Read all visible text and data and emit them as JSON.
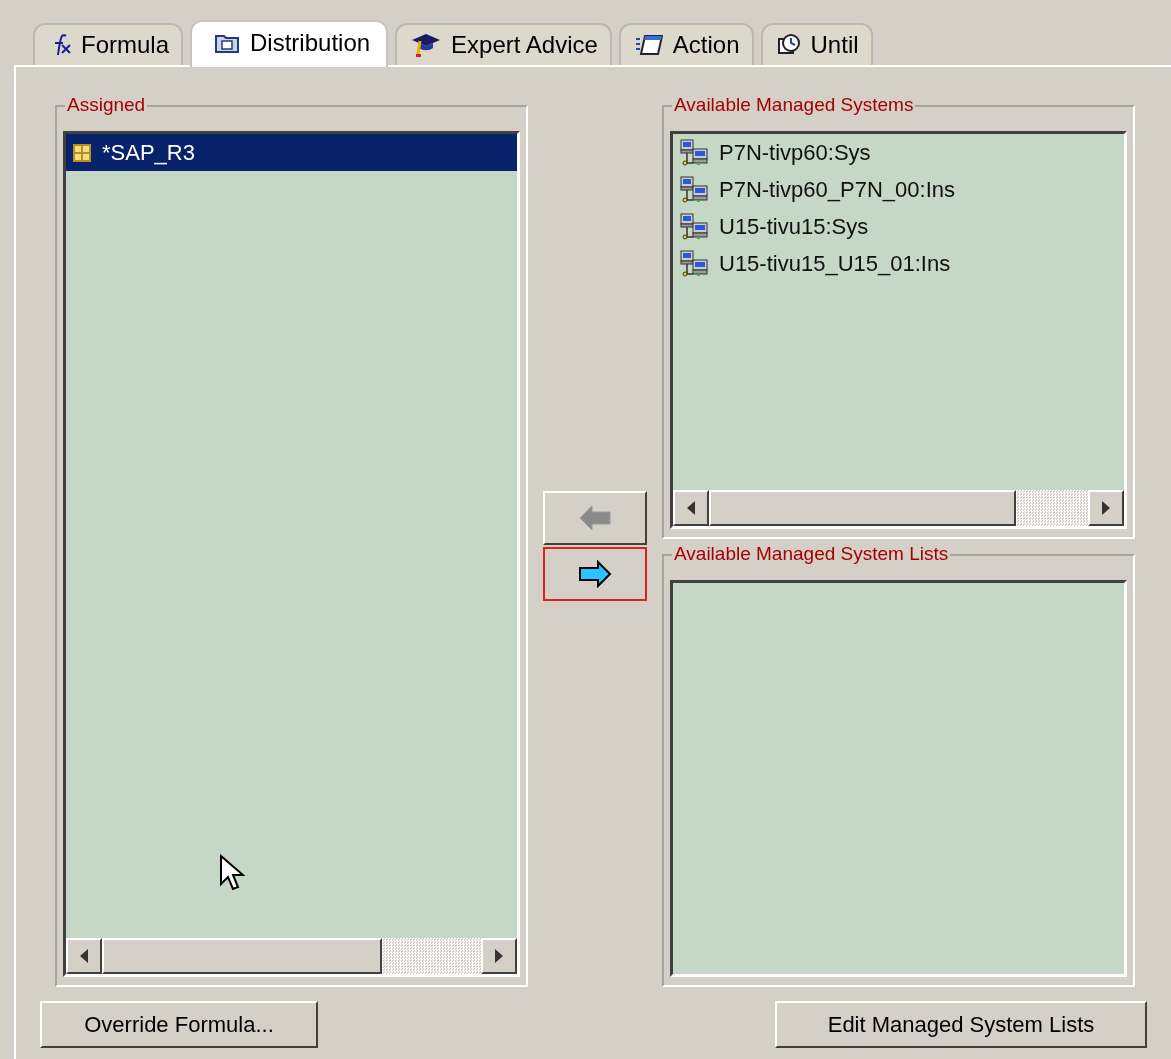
{
  "tabs": [
    {
      "label": "Formula",
      "kind": "formula",
      "selected": false
    },
    {
      "label": "Distribution",
      "kind": "distribution",
      "selected": true
    },
    {
      "label": "Expert Advice",
      "kind": "expert",
      "selected": false
    },
    {
      "label": "Action",
      "kind": "action",
      "selected": false
    },
    {
      "label": "Until",
      "kind": "until",
      "selected": false
    }
  ],
  "assigned": {
    "title": "Assigned",
    "items": [
      {
        "label": "*SAP_R3",
        "kind": "group",
        "selected": true
      }
    ]
  },
  "available_managed_systems": {
    "title": "Available Managed Systems",
    "items": [
      {
        "label": "P7N-tivp60:Sys",
        "kind": "system",
        "selected": false
      },
      {
        "label": "P7N-tivp60_P7N_00:Ins",
        "kind": "system",
        "selected": false
      },
      {
        "label": "U15-tivu15:Sys",
        "kind": "system",
        "selected": false
      },
      {
        "label": "U15-tivu15_U15_01:Ins",
        "kind": "system",
        "selected": false
      }
    ]
  },
  "available_managed_system_lists": {
    "title": "Available Managed System Lists"
  },
  "move_buttons": [
    {
      "kind": "left",
      "disabled": true,
      "focused": false
    },
    {
      "kind": "right",
      "disabled": false,
      "focused": true
    }
  ],
  "buttons": [
    "Override Formula...",
    "Edit Managed System Lists"
  ]
}
